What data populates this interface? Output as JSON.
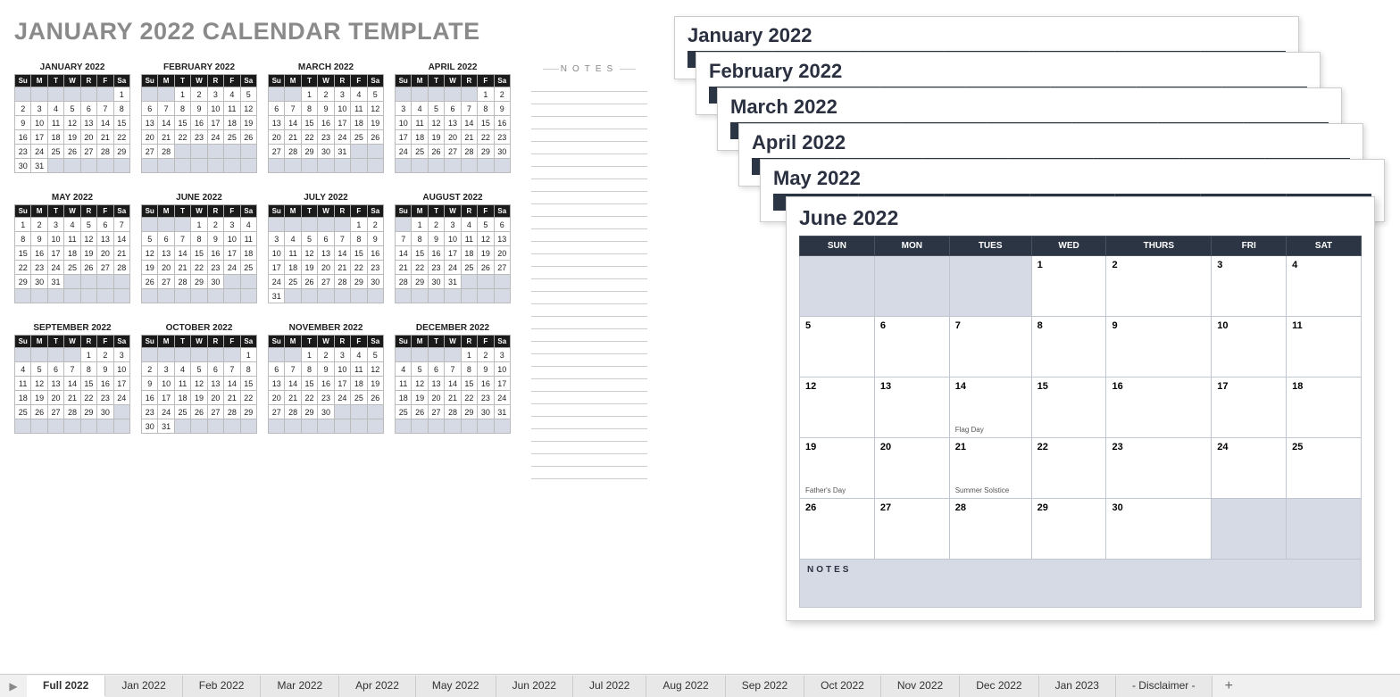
{
  "title": "JANUARY 2022 CALENDAR TEMPLATE",
  "notes_label": "NOTES",
  "day_headers_short": [
    "Su",
    "M",
    "T",
    "W",
    "R",
    "F",
    "Sa"
  ],
  "day_headers_long": [
    "SUN",
    "MON",
    "TUES",
    "WED",
    "THURS",
    "FRI",
    "SAT"
  ],
  "mini_months": [
    {
      "name": "JANUARY 2022",
      "start": 6,
      "days": 31
    },
    {
      "name": "FEBRUARY 2022",
      "start": 2,
      "days": 28
    },
    {
      "name": "MARCH 2022",
      "start": 2,
      "days": 31
    },
    {
      "name": "APRIL 2022",
      "start": 5,
      "days": 30
    },
    {
      "name": "MAY 2022",
      "start": 0,
      "days": 31
    },
    {
      "name": "JUNE 2022",
      "start": 3,
      "days": 30
    },
    {
      "name": "JULY 2022",
      "start": 5,
      "days": 31
    },
    {
      "name": "AUGUST 2022",
      "start": 1,
      "days": 31
    },
    {
      "name": "SEPTEMBER 2022",
      "start": 4,
      "days": 30
    },
    {
      "name": "OCTOBER 2022",
      "start": 6,
      "days": 31
    },
    {
      "name": "NOVEMBER 2022",
      "start": 2,
      "days": 30
    },
    {
      "name": "DECEMBER 2022",
      "start": 4,
      "days": 31
    }
  ],
  "stacked_cards": [
    {
      "title": "January 2022"
    },
    {
      "title": "February 2022"
    },
    {
      "title": "March 2022"
    },
    {
      "title": "April 2022"
    },
    {
      "title": "May 2022"
    }
  ],
  "june": {
    "title": "June 2022",
    "start": 3,
    "days": 30,
    "events": {
      "14": "Flag Day",
      "19": "Father's Day",
      "21": "Summer Solstice"
    },
    "notes_label": "NOTES"
  },
  "tabs": [
    "Full 2022",
    "Jan 2022",
    "Feb 2022",
    "Mar 2022",
    "Apr 2022",
    "May 2022",
    "Jun 2022",
    "Jul 2022",
    "Aug 2022",
    "Sep 2022",
    "Oct 2022",
    "Nov 2022",
    "Dec 2022",
    "Jan 2023",
    "- Disclaimer -"
  ],
  "active_tab": 0
}
